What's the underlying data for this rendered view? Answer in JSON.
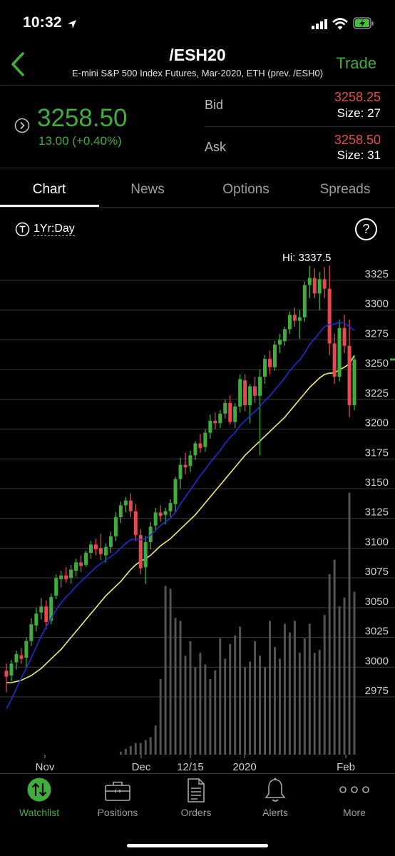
{
  "status": {
    "time": "10:32"
  },
  "header": {
    "title": "/ESH20",
    "subtitle": "E-mini S&P 500 Index Futures, Mar-2020, ETH (prev. /ESH0)",
    "trade_label": "Trade"
  },
  "quote": {
    "price": "3258.50",
    "change": "13.00 (+0.40%)",
    "bid_label": "Bid",
    "bid": "3258.25",
    "bid_size": "Size: 27",
    "ask_label": "Ask",
    "ask": "3258.50",
    "ask_size": "Size: 31"
  },
  "tabs": [
    {
      "label": "Chart",
      "active": true
    },
    {
      "label": "News"
    },
    {
      "label": "Options"
    },
    {
      "label": "Spreads"
    }
  ],
  "chart_controls": {
    "range": "1Yr:Day",
    "help": "?"
  },
  "chart_data": {
    "type": "candlestick",
    "high_label": "Hi: 3337.5",
    "y_ticks": [
      3325,
      3300,
      3275,
      3250,
      3225,
      3200,
      3175,
      3150,
      3125,
      3100,
      3075,
      3050,
      3025,
      3000,
      2975
    ],
    "ylim": [
      2955,
      3340
    ],
    "x_tick_labels": [
      "Nov",
      "Dec",
      "12/15",
      "2020",
      "Feb"
    ],
    "colors": {
      "up": "#3fae3b",
      "down": "#e74a4a",
      "ma_fast": "#1c2fd6",
      "ma_slow": "#f0eb6a",
      "volume": "#545454",
      "last_price_marker": "#3fae3b"
    },
    "candles": [
      {
        "date": "10/24",
        "o": 2997,
        "h": 3003,
        "l": 2979,
        "c": 2992
      },
      {
        "date": "10/25",
        "o": 2993,
        "h": 3006,
        "l": 2988,
        "c": 3003
      },
      {
        "date": "10/28",
        "o": 3004,
        "h": 3014,
        "l": 2998,
        "c": 3011
      },
      {
        "date": "10/29",
        "o": 3010,
        "h": 3016,
        "l": 3003,
        "c": 3007
      },
      {
        "date": "10/30",
        "o": 3008,
        "h": 3025,
        "l": 3000,
        "c": 3022
      },
      {
        "date": "10/31",
        "o": 3022,
        "h": 3041,
        "l": 3018,
        "c": 3036
      },
      {
        "date": "11/01",
        "o": 3035,
        "h": 3050,
        "l": 3030,
        "c": 3045
      },
      {
        "date": "11/04",
        "o": 3046,
        "h": 3058,
        "l": 3040,
        "c": 3051
      },
      {
        "date": "11/05",
        "o": 3051,
        "h": 3056,
        "l": 3032,
        "c": 3038
      },
      {
        "date": "11/06",
        "o": 3039,
        "h": 3062,
        "l": 3036,
        "c": 3059
      },
      {
        "date": "11/07",
        "o": 3060,
        "h": 3078,
        "l": 3057,
        "c": 3075
      },
      {
        "date": "11/08",
        "o": 3074,
        "h": 3081,
        "l": 3067,
        "c": 3077
      },
      {
        "date": "11/11",
        "o": 3077,
        "h": 3084,
        "l": 3071,
        "c": 3074
      },
      {
        "date": "11/12",
        "o": 3075,
        "h": 3086,
        "l": 3070,
        "c": 3082
      },
      {
        "date": "11/13",
        "o": 3081,
        "h": 3091,
        "l": 3076,
        "c": 3088
      },
      {
        "date": "11/14",
        "o": 3088,
        "h": 3094,
        "l": 3080,
        "c": 3085
      },
      {
        "date": "11/15",
        "o": 3086,
        "h": 3098,
        "l": 3084,
        "c": 3096
      },
      {
        "date": "11/18",
        "o": 3096,
        "h": 3106,
        "l": 3091,
        "c": 3103
      },
      {
        "date": "11/19",
        "o": 3103,
        "h": 3108,
        "l": 3094,
        "c": 3099
      },
      {
        "date": "11/20",
        "o": 3100,
        "h": 3112,
        "l": 3090,
        "c": 3095
      },
      {
        "date": "11/21",
        "o": 3094,
        "h": 3104,
        "l": 3088,
        "c": 3101
      },
      {
        "date": "11/22",
        "o": 3101,
        "h": 3114,
        "l": 3096,
        "c": 3110
      },
      {
        "date": "11/25",
        "o": 3110,
        "h": 3130,
        "l": 3106,
        "c": 3126
      },
      {
        "date": "11/26",
        "o": 3126,
        "h": 3139,
        "l": 3121,
        "c": 3136
      },
      {
        "date": "11/27",
        "o": 3136,
        "h": 3143,
        "l": 3130,
        "c": 3140
      },
      {
        "date": "11/29",
        "o": 3140,
        "h": 3146,
        "l": 3126,
        "c": 3131
      },
      {
        "date": "12/02",
        "o": 3131,
        "h": 3137,
        "l": 3106,
        "c": 3111
      },
      {
        "date": "12/03",
        "o": 3111,
        "h": 3116,
        "l": 3078,
        "c": 3083
      },
      {
        "date": "12/04",
        "o": 3084,
        "h": 3110,
        "l": 3070,
        "c": 3105
      },
      {
        "date": "12/05",
        "o": 3105,
        "h": 3122,
        "l": 3099,
        "c": 3118
      },
      {
        "date": "12/06",
        "o": 3119,
        "h": 3134,
        "l": 3114,
        "c": 3130
      },
      {
        "date": "12/09",
        "o": 3130,
        "h": 3136,
        "l": 3122,
        "c": 3127
      },
      {
        "date": "12/10",
        "o": 3128,
        "h": 3134,
        "l": 3120,
        "c": 3131
      },
      {
        "date": "12/11",
        "o": 3131,
        "h": 3141,
        "l": 3126,
        "c": 3138
      },
      {
        "date": "12/12",
        "o": 3137,
        "h": 3160,
        "l": 3130,
        "c": 3158
      },
      {
        "date": "12/13",
        "o": 3158,
        "h": 3176,
        "l": 3150,
        "c": 3170
      },
      {
        "date": "12/16",
        "o": 3170,
        "h": 3180,
        "l": 3162,
        "c": 3168
      },
      {
        "date": "12/17",
        "o": 3169,
        "h": 3182,
        "l": 3164,
        "c": 3178
      },
      {
        "date": "12/18",
        "o": 3178,
        "h": 3190,
        "l": 3174,
        "c": 3188
      },
      {
        "date": "12/19",
        "o": 3188,
        "h": 3196,
        "l": 3180,
        "c": 3184
      },
      {
        "date": "12/20",
        "o": 3185,
        "h": 3200,
        "l": 3181,
        "c": 3197
      },
      {
        "date": "12/23",
        "o": 3197,
        "h": 3212,
        "l": 3192,
        "c": 3207
      },
      {
        "date": "12/24",
        "o": 3207,
        "h": 3214,
        "l": 3200,
        "c": 3205
      },
      {
        "date": "12/26",
        "o": 3205,
        "h": 3216,
        "l": 3201,
        "c": 3213
      },
      {
        "date": "12/27",
        "o": 3213,
        "h": 3225,
        "l": 3209,
        "c": 3222
      },
      {
        "date": "12/30",
        "o": 3222,
        "h": 3228,
        "l": 3204,
        "c": 3206
      },
      {
        "date": "12/31",
        "o": 3206,
        "h": 3222,
        "l": 3201,
        "c": 3219
      },
      {
        "date": "01/02",
        "o": 3219,
        "h": 3246,
        "l": 3214,
        "c": 3242
      },
      {
        "date": "01/03",
        "o": 3241,
        "h": 3246,
        "l": 3215,
        "c": 3220
      },
      {
        "date": "01/06",
        "o": 3220,
        "h": 3238,
        "l": 3205,
        "c": 3236
      },
      {
        "date": "01/07",
        "o": 3236,
        "h": 3244,
        "l": 3222,
        "c": 3228
      },
      {
        "date": "01/08",
        "o": 3228,
        "h": 3250,
        "l": 3178,
        "c": 3244
      },
      {
        "date": "01/09",
        "o": 3244,
        "h": 3262,
        "l": 3238,
        "c": 3259
      },
      {
        "date": "01/10",
        "o": 3259,
        "h": 3266,
        "l": 3246,
        "c": 3252
      },
      {
        "date": "01/13",
        "o": 3252,
        "h": 3274,
        "l": 3249,
        "c": 3271
      },
      {
        "date": "01/14",
        "o": 3271,
        "h": 3280,
        "l": 3264,
        "c": 3275
      },
      {
        "date": "01/15",
        "o": 3274,
        "h": 3286,
        "l": 3270,
        "c": 3284
      },
      {
        "date": "01/16",
        "o": 3284,
        "h": 3299,
        "l": 3280,
        "c": 3296
      },
      {
        "date": "01/17",
        "o": 3296,
        "h": 3302,
        "l": 3286,
        "c": 3291
      },
      {
        "date": "01/21",
        "o": 3291,
        "h": 3300,
        "l": 3276,
        "c": 3294
      },
      {
        "date": "01/22",
        "o": 3294,
        "h": 3324,
        "l": 3290,
        "c": 3321
      },
      {
        "date": "01/23",
        "o": 3321,
        "h": 3337,
        "l": 3310,
        "c": 3327
      },
      {
        "date": "01/24",
        "o": 3327,
        "h": 3335,
        "l": 3310,
        "c": 3314
      },
      {
        "date": "01/27",
        "o": 3314,
        "h": 3332,
        "l": 3300,
        "c": 3326
      },
      {
        "date": "01/28",
        "o": 3326,
        "h": 3336,
        "l": 3310,
        "c": 3318
      },
      {
        "date": "01/29",
        "o": 3318,
        "h": 3337.5,
        "l": 3262,
        "c": 3272
      },
      {
        "date": "01/30",
        "o": 3272,
        "h": 3280,
        "l": 3238,
        "c": 3244
      },
      {
        "date": "01/31",
        "o": 3244,
        "h": 3292,
        "l": 3240,
        "c": 3285
      },
      {
        "date": "02/03",
        "o": 3285,
        "h": 3296,
        "l": 3264,
        "c": 3270
      },
      {
        "date": "02/04",
        "o": 3270,
        "h": 3292,
        "l": 3210,
        "c": 3220
      },
      {
        "date": "02/05",
        "o": 3220,
        "h": 3262,
        "l": 3216,
        "c": 3258.5
      }
    ],
    "ma_fast": [
      2965,
      2973,
      2982,
      2991,
      2999,
      3008,
      3017,
      3026,
      3034,
      3041,
      3048,
      3054,
      3059,
      3063,
      3068,
      3072,
      3076,
      3080,
      3084,
      3087,
      3090,
      3093,
      3096,
      3100,
      3104,
      3107,
      3108,
      3107,
      3108,
      3111,
      3115,
      3119,
      3122,
      3125,
      3130,
      3137,
      3143,
      3149,
      3155,
      3161,
      3166,
      3172,
      3177,
      3182,
      3188,
      3193,
      3197,
      3203,
      3207,
      3211,
      3215,
      3219,
      3224,
      3228,
      3233,
      3238,
      3243,
      3249,
      3254,
      3258,
      3264,
      3271,
      3276,
      3281,
      3286,
      3288,
      3288,
      3290,
      3289,
      3286,
      3283
    ],
    "ma_slow": [
      2987,
      2987,
      2988,
      2989,
      2991,
      2993,
      2996,
      2999,
      3003,
      3007,
      3011,
      3015,
      3020,
      3025,
      3030,
      3035,
      3040,
      3045,
      3050,
      3055,
      3060,
      3064,
      3068,
      3072,
      3077,
      3082,
      3086,
      3089,
      3091,
      3094,
      3098,
      3102,
      3105,
      3108,
      3112,
      3116,
      3120,
      3124,
      3128,
      3133,
      3138,
      3143,
      3148,
      3153,
      3158,
      3163,
      3168,
      3173,
      3178,
      3182,
      3186,
      3190,
      3194,
      3198,
      3202,
      3206,
      3210,
      3215,
      3220,
      3225,
      3230,
      3235,
      3239,
      3243,
      3246,
      3247,
      3247,
      3250,
      3252,
      3255,
      3262
    ],
    "volume": [
      0,
      0,
      0,
      0,
      0,
      0,
      0,
      0,
      0,
      0,
      0,
      0,
      0,
      0,
      0,
      0,
      0,
      0,
      0,
      0,
      0,
      0,
      0,
      0.01,
      0.02,
      0.03,
      0.04,
      0.04,
      0.05,
      0.06,
      0.1,
      0.26,
      0.58,
      0.57,
      0.47,
      0.46,
      0.34,
      0.39,
      0.3,
      0.35,
      0.31,
      0.26,
      0.29,
      0.4,
      0.33,
      0.38,
      0.41,
      0.44,
      0.3,
      0.32,
      0.39,
      0.34,
      0.3,
      0.46,
      0.37,
      0.33,
      0.45,
      0.42,
      0.46,
      0.35,
      0.4,
      0.45,
      0.35,
      0.36,
      0.48,
      0.62,
      0.67,
      0.51,
      0.54,
      0.9,
      0.56
    ]
  },
  "tabbar": [
    {
      "label": "Watchlist",
      "icon": "watchlist-icon",
      "active": true
    },
    {
      "label": "Positions",
      "icon": "briefcase-icon"
    },
    {
      "label": "Orders",
      "icon": "document-icon"
    },
    {
      "label": "Alerts",
      "icon": "bell-icon"
    },
    {
      "label": "More",
      "icon": "more-dots-icon"
    }
  ]
}
